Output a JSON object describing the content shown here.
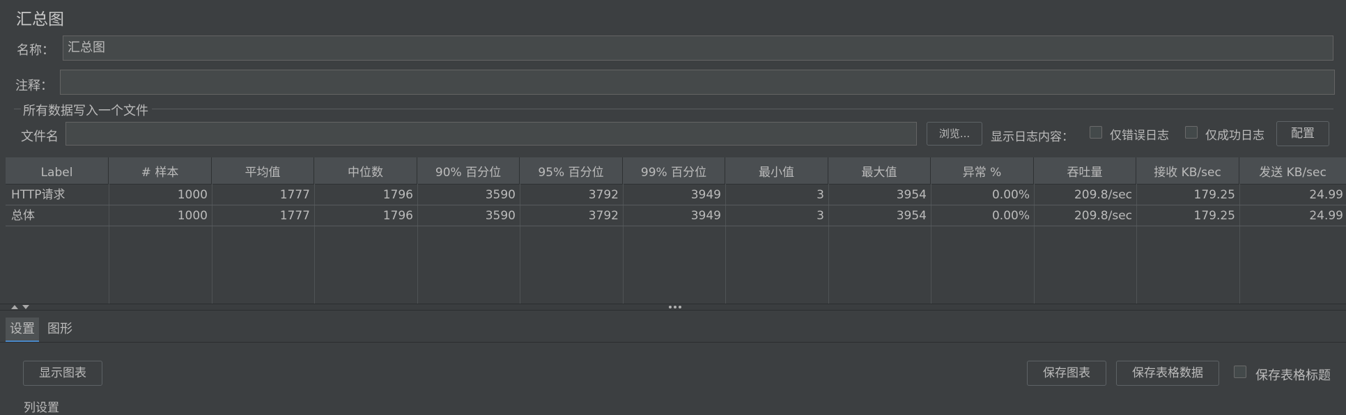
{
  "title": "汇总图",
  "name_label": "名称：",
  "name_value": "汇总图",
  "comment_label": "注释：",
  "comment_value": "",
  "file_group_title": "所有数据写入一个文件",
  "file_label": "文件名",
  "file_value": "",
  "browse_button": "浏览...",
  "log_display_label": "显示日志内容：",
  "errors_only_label": "仅错误日志",
  "success_only_label": "仅成功日志",
  "configure_button": "配置",
  "table": {
    "headers": [
      "Label",
      "# 样本",
      "平均值",
      "中位数",
      "90% 百分位",
      "95% 百分位",
      "99% 百分位",
      "最小值",
      "最大值",
      "异常 %",
      "吞吐量",
      "接收 KB/sec",
      "发送 KB/sec"
    ],
    "rows": [
      [
        "HTTP请求",
        "1000",
        "1777",
        "1796",
        "3590",
        "3792",
        "3949",
        "3",
        "3954",
        "0.00%",
        "209.8/sec",
        "179.25",
        "24.99"
      ],
      [
        "总体",
        "1000",
        "1777",
        "1796",
        "3590",
        "3792",
        "3949",
        "3",
        "3954",
        "0.00%",
        "209.8/sec",
        "179.25",
        "24.99"
      ]
    ]
  },
  "tabs": [
    "设置",
    "图形"
  ],
  "show_chart_button": "显示图表",
  "save_chart_button": "保存图表",
  "save_table_button": "保存表格数据",
  "save_table_header_label": "保存表格标题",
  "partial_text": "列设置"
}
